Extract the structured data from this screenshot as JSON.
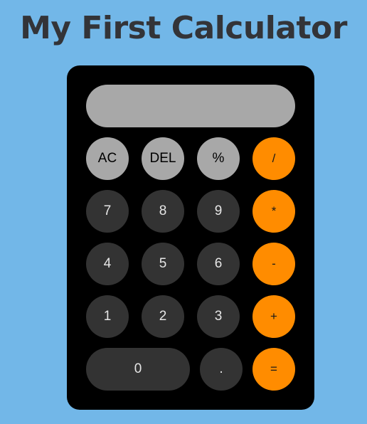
{
  "page": {
    "title": "My First Calculator"
  },
  "display": {
    "value": ""
  },
  "keys": {
    "ac": "AC",
    "del": "DEL",
    "percent": "%",
    "divide": "/",
    "seven": "7",
    "eight": "8",
    "nine": "9",
    "multiply": "*",
    "four": "4",
    "five": "5",
    "six": "6",
    "subtract": "-",
    "one": "1",
    "two": "2",
    "three": "3",
    "add": "+",
    "zero": "0",
    "decimal": ".",
    "equals": "="
  },
  "colors": {
    "background": "#72b7e8",
    "body": "#000000",
    "function_key": "#a8a8a8",
    "number_key": "#333333",
    "operator_key": "#ff8c00",
    "title": "#333438"
  }
}
